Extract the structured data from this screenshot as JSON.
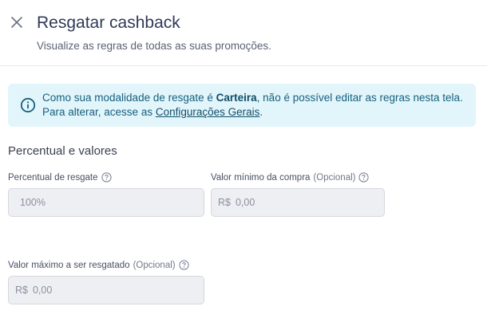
{
  "header": {
    "title": "Resgatar cashback",
    "subtitle": "Visualize as regras de todas as suas promoções."
  },
  "alert": {
    "text_before": "Como sua modalidade de resgate é ",
    "bold": "Carteira",
    "text_middle": ", não é possível editar as regras nesta tela. Para alterar, acesse as ",
    "link": "Configurações Gerais",
    "text_after": "."
  },
  "section": {
    "title": "Percentual e valores"
  },
  "fields": {
    "percentual": {
      "label": "Percentual de resgate",
      "value": "100%"
    },
    "valor_minimo": {
      "label": "Valor mínimo da compra",
      "optional": "(Opcional)",
      "prefix": "R$",
      "value": "0,00"
    },
    "valor_maximo": {
      "label": "Valor máximo a ser resgatado",
      "optional": "(Opcional)",
      "prefix": "R$",
      "value": "0,00"
    }
  },
  "colors": {
    "alert_bg": "#e2f5fb",
    "alert_text": "#16607d",
    "input_bg": "#eeeff2"
  }
}
